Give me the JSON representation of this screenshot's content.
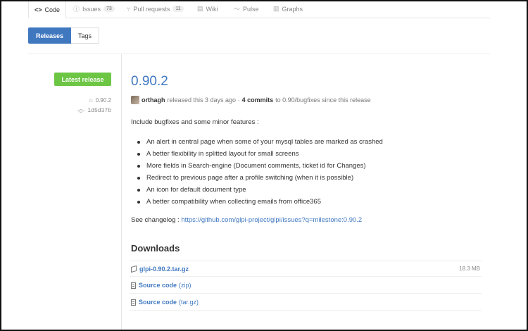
{
  "repo_nav": {
    "tabs": [
      {
        "label": "Code",
        "icon": "code-icon",
        "selected": true
      },
      {
        "label": "Issues",
        "icon": "issue-opened-icon",
        "count": "73"
      },
      {
        "label": "Pull requests",
        "icon": "git-pull-request-icon",
        "count": "11"
      },
      {
        "label": "Wiki",
        "icon": "book-icon"
      },
      {
        "label": "Pulse",
        "icon": "pulse-icon"
      },
      {
        "label": "Graphs",
        "icon": "graph-icon"
      }
    ]
  },
  "subnav": {
    "releases": "Releases",
    "tags": "Tags"
  },
  "release": {
    "badge": "Latest release",
    "tag": "0.90.2",
    "commit": "1d5d37b",
    "title": "0.90.2",
    "author": "orthagh",
    "released_text": "released this 3 days ago ·",
    "commits_link": "4 commits",
    "to_branch_text": "to 0.90/bugfixes since this release",
    "intro": "Include bugfixes and some minor features :",
    "bullets": [
      "An alert in central page when some of your mysql tables are marked as crashed",
      "A better flexibility in splitted layout for small screens",
      "More fields in Search-engine (Document comments, ticket id for Changes)",
      "Redirect to previous page after a profile switching (when it is possible)",
      "An icon for default document type",
      "A better compatibility when collecting emails from office365"
    ],
    "changelog_label": "See changelog :",
    "changelog_url": "https://github.com/glpi-project/glpi/issues?q=milestone:0.90.2"
  },
  "downloads": {
    "title": "Downloads",
    "items": [
      {
        "name": "glpi-0.90.2.tar.gz",
        "suffix": "",
        "size": "18.3 MB",
        "icon": "package-icon"
      },
      {
        "name": "Source code",
        "suffix": "(zip)",
        "size": "",
        "icon": "file-zip-icon"
      },
      {
        "name": "Source code",
        "suffix": "(tar.gz)",
        "size": "",
        "icon": "file-zip-icon"
      }
    ]
  },
  "colors": {
    "accent": "#4078c0",
    "badge_green": "#6cc644",
    "selected_tab_top": "#d26911"
  }
}
